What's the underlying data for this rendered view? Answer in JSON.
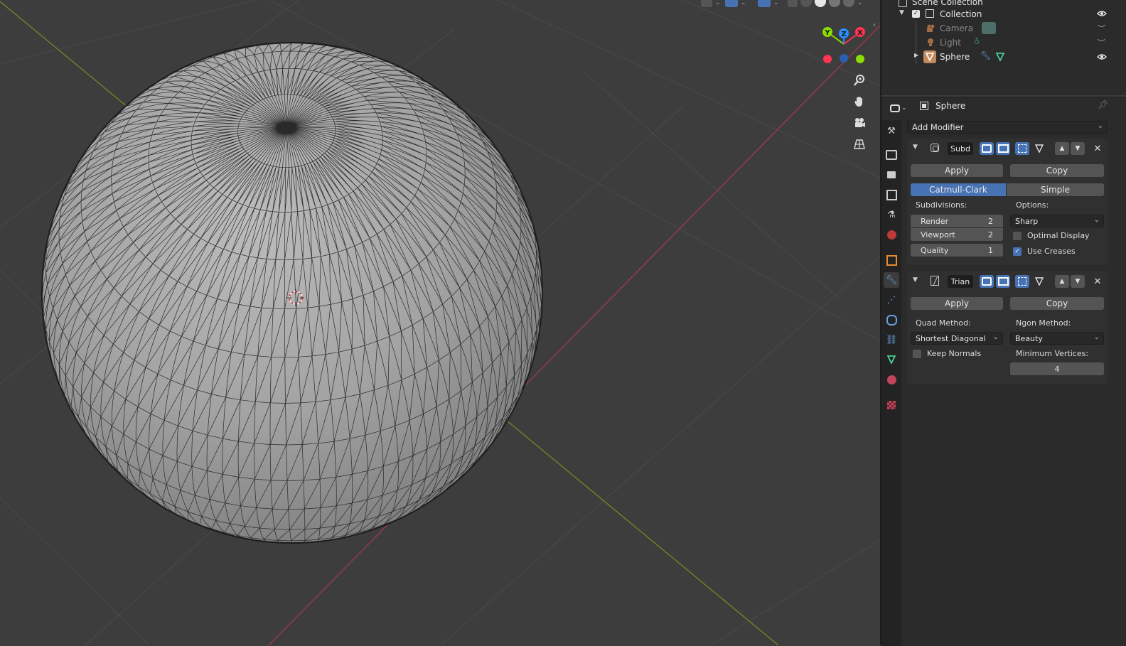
{
  "outliner": {
    "scene_collection": "Scene Collection",
    "rows": [
      {
        "label": "Collection"
      },
      {
        "label": "Camera"
      },
      {
        "label": "Light"
      },
      {
        "label": "Sphere"
      }
    ]
  },
  "properties": {
    "object_name": "Sphere",
    "add_modifier": "Add Modifier",
    "modifiers": [
      {
        "name": "Subd",
        "apply_label": "Apply",
        "copy_label": "Copy",
        "type_options": [
          "Catmull-Clark",
          "Simple"
        ],
        "selected_type": "Catmull-Clark",
        "subdivisions_label": "Subdivisions:",
        "options_label": "Options:",
        "fields": [
          {
            "label": "Render",
            "value": "2"
          },
          {
            "label": "Viewport",
            "value": "2"
          },
          {
            "label": "Quality",
            "value": "1"
          }
        ],
        "uv_smooth": "Sharp",
        "optimal_display": {
          "label": "Optimal Display",
          "checked": false
        },
        "use_creases": {
          "label": "Use Creases",
          "checked": true
        }
      },
      {
        "name": "Trian",
        "apply_label": "Apply",
        "copy_label": "Copy",
        "quad_method_label": "Quad Method:",
        "ngon_method_label": "Ngon Method:",
        "quad_method": "Shortest Diagonal",
        "ngon_method": "Beauty",
        "keep_normals": {
          "label": "Keep Normals",
          "checked": false
        },
        "min_vertices_label": "Minimum Vertices:",
        "min_vertices": "4"
      }
    ]
  },
  "gizmo": {
    "x": "X",
    "y": "Y",
    "z": "Z"
  },
  "colors": {
    "axis_x": "#ff3352",
    "axis_y": "#8bdc00",
    "axis_z": "#2890ff",
    "accent": "#4772b3",
    "viewport_bg": "#3d3d3d",
    "panel_bg": "#2b2b2b"
  }
}
